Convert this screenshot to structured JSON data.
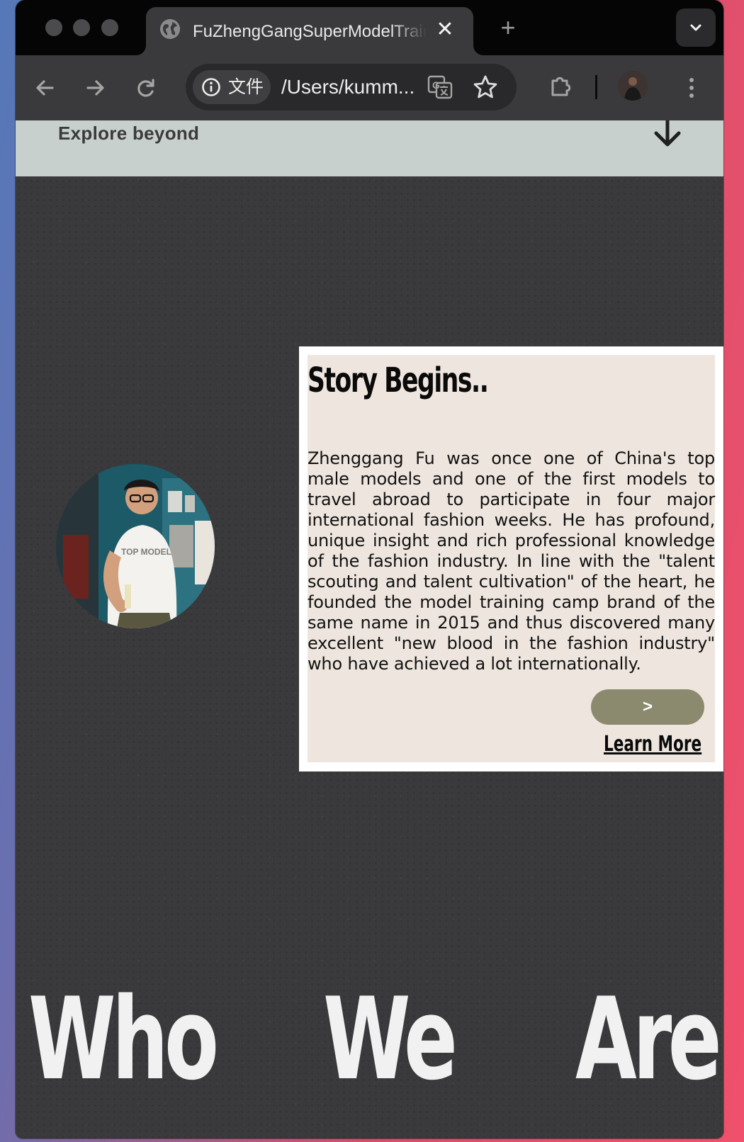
{
  "browser": {
    "tab_title": "FuZhengGangSuperModelTrainingCamp",
    "tab_close": "✕",
    "new_tab": "+",
    "address_chip_label": "文件",
    "url": "/Users/kumm...",
    "icons": [
      "back-arrow-icon",
      "forward-arrow-icon",
      "reload-icon",
      "info-icon",
      "translate-icon",
      "star-icon",
      "extensions-icon",
      "profile-avatar",
      "more-menu-icon",
      "tab-search-icon",
      "globe-icon"
    ]
  },
  "page": {
    "explore": {
      "label": "Explore beyond"
    },
    "story": {
      "title": "Story Begins..",
      "body": "Zhenggang Fu was once one of China's top male models and one of the first models to travel abroad to participate in four major international fashion weeks. He has profound, unique insight and rich professional knowledge of the fashion industry. In line with the \"talent scouting and talent cultivation\" of the heart, he founded the model training camp brand of the same name in 2015 and thus discovered many excellent \"new blood in the fashion industry\" who have achieved a lot internationally.",
      "arrow_button": ">",
      "learn_more": "Learn More"
    },
    "heading_words": [
      "Who",
      "We",
      "Are"
    ]
  },
  "colors": {
    "page_bg": "#3a3a3c",
    "explore_bar": "#c8d0cd",
    "card_bg": "#eee6de",
    "button": "#8b8a6e",
    "heading_text": "#f1f1f1"
  }
}
